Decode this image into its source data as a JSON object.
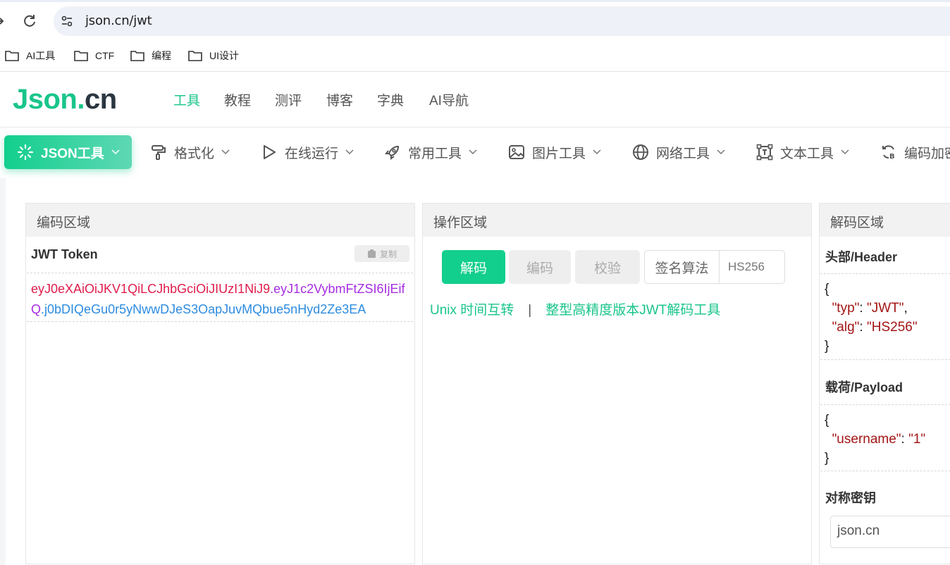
{
  "browser": {
    "url": "json.cn/jwt",
    "bookmarks": [
      "AI工具",
      "CTF",
      "编程",
      "UI设计"
    ]
  },
  "site": {
    "logo_json": "Json",
    "logo_dot": ".",
    "logo_cn": "cn",
    "nav": [
      "工具",
      "教程",
      "测评",
      "博客",
      "字典",
      "AI导航"
    ],
    "active_nav": "工具",
    "accent_color": "#19c58a"
  },
  "toolbar": {
    "items": [
      {
        "label": "JSON工具",
        "icon": "sparkle-icon"
      },
      {
        "label": "格式化",
        "icon": "paint-roller-icon"
      },
      {
        "label": "在线运行",
        "icon": "play-icon"
      },
      {
        "label": "常用工具",
        "icon": "rocket-icon"
      },
      {
        "label": "图片工具",
        "icon": "image-icon"
      },
      {
        "label": "网络工具",
        "icon": "globe-icon"
      },
      {
        "label": "文本工具",
        "icon": "text-frame-icon"
      },
      {
        "label": "编码加密",
        "icon": "refresh-b-icon"
      }
    ]
  },
  "encode_panel": {
    "title": "编码区域",
    "subtitle": "JWT Token",
    "copy_label": "复制",
    "token_header": "eyJ0eXAiOiJKV1QiLCJhbGciOiJIUzI1NiJ9",
    "token_payload": "eyJ1c2VybmFtZSI6IjEifQ",
    "token_signature": "j0bDIQeGu0r5yNwwDJeS3OapJuvMQbue5nHyd2Ze3EA",
    "token_dot": "."
  },
  "action_panel": {
    "title": "操作区域",
    "decode_label": "解码",
    "encode_label": "编码",
    "verify_label": "校验",
    "alg_label": "签名算法",
    "alg_value": "HS256",
    "link1": "Unix 时间互转",
    "link_sep": "|",
    "link2": "整型高精度版本JWT解码工具"
  },
  "decode_panel": {
    "title": "解码区域",
    "header_title": "头部/Header",
    "header_lines": {
      "open": "{",
      "l1_key": "\"typ\"",
      "l1_colon": ": ",
      "l1_val": "\"JWT\"",
      "l1_comma": ",",
      "l2_key": "\"alg\"",
      "l2_colon": ": ",
      "l2_val": "\"HS256\"",
      "close": "}"
    },
    "payload_title": "载荷/Payload",
    "payload_lines": {
      "open": "{",
      "l1_key": "\"username\"",
      "l1_colon": ": ",
      "l1_val": "\"1\"",
      "close": "}"
    },
    "secret_title": "对称密钥",
    "secret_value": "json.cn"
  }
}
